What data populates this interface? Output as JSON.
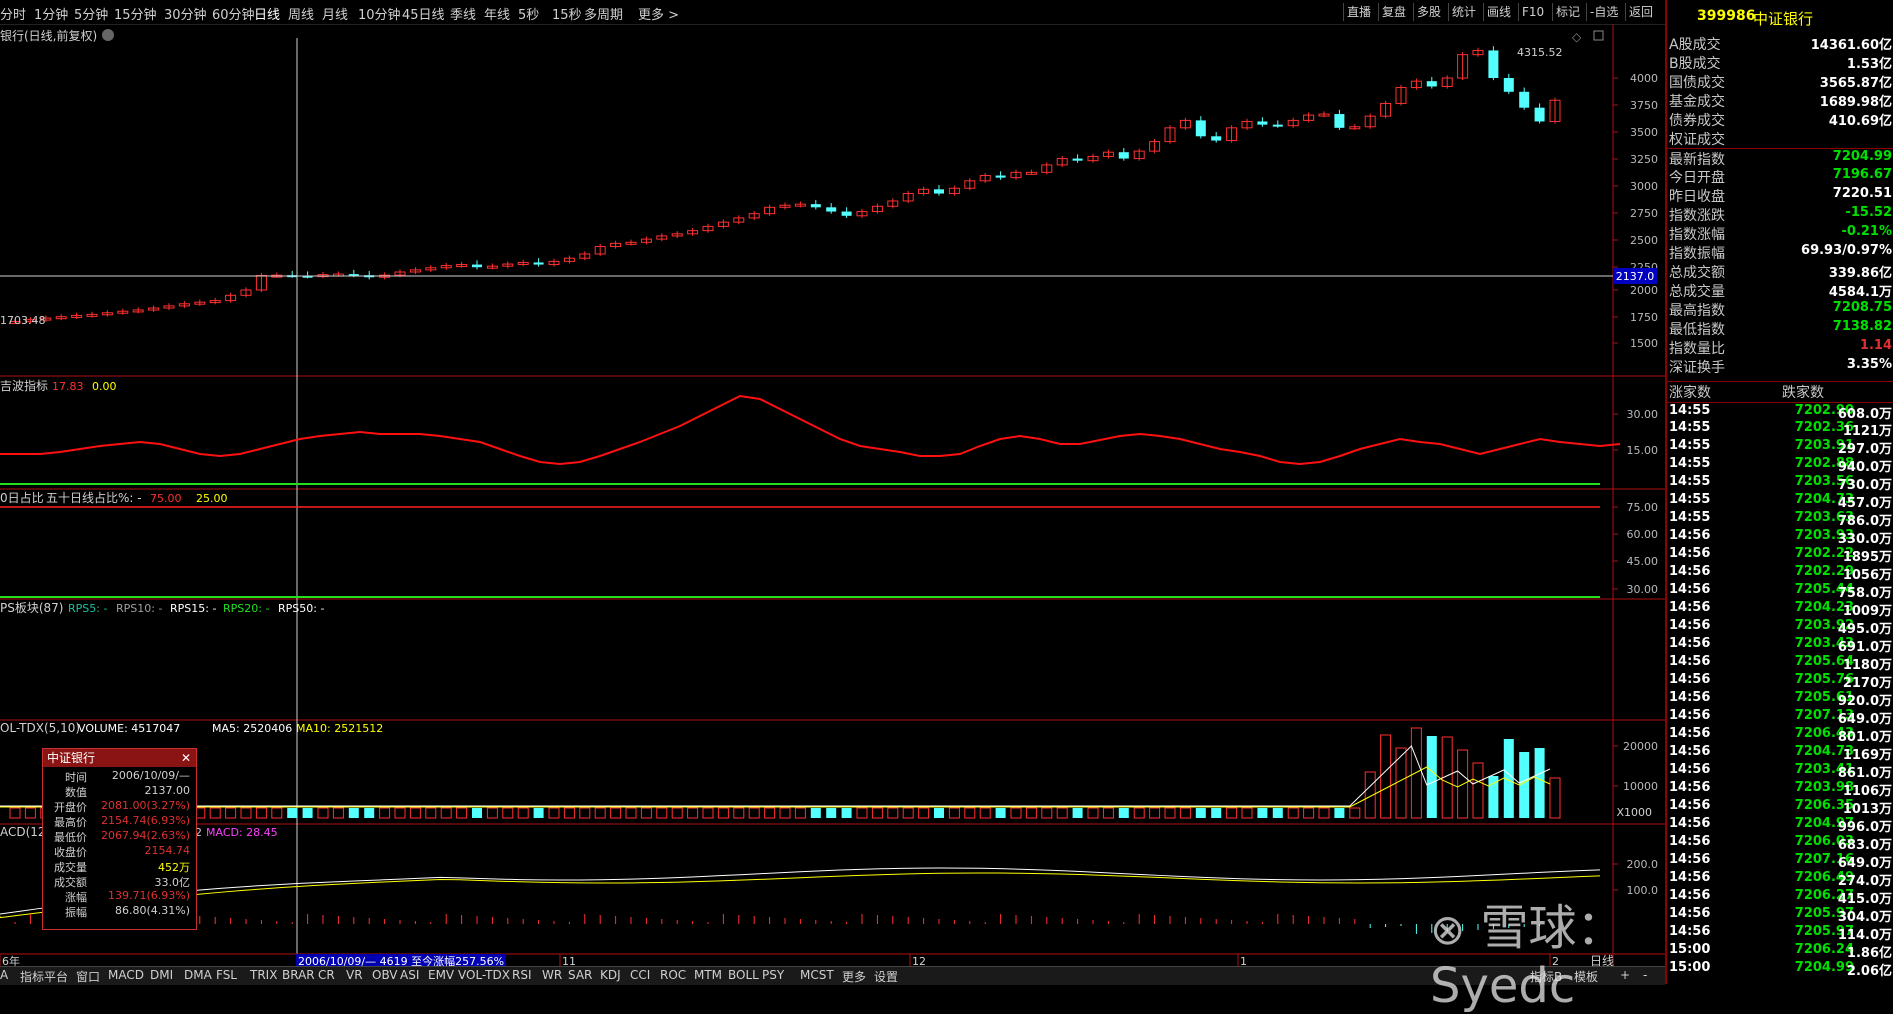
{
  "toolbar": {
    "periods": [
      "分时",
      "1分钟",
      "5分钟",
      "15分钟",
      "30分钟",
      "60分钟",
      "日线",
      "周线",
      "月线",
      "10分钟",
      "45日线",
      "季线",
      "年线",
      "5秒",
      "15秒",
      "多周期",
      "更多 >"
    ],
    "right_buttons": [
      "直播",
      "复盘",
      "多股",
      "统计",
      "画线",
      "F10",
      "标记",
      "-自选",
      "返回"
    ]
  },
  "main_chart": {
    "title": "银行(日线,前复权)",
    "high_label": "4315.52",
    "low_label": "1703.48",
    "crosshair_value": "2137.0",
    "y_ticks": [
      "4000",
      "3750",
      "3500",
      "3250",
      "3000",
      "2750",
      "2500",
      "2250",
      "2000",
      "1750",
      "1500"
    ]
  },
  "indicator_labels": {
    "wave": "吉波指标",
    "wave_val1": "17.83",
    "wave_val2": "0.00",
    "wave_ticks": [
      "30.00",
      "15.00"
    ],
    "ma50": "0日占比",
    "ma50b": "五十日线占比%: -",
    "ma50_v1": "75.00",
    "ma50_v2": "25.00",
    "ma50_ticks": [
      "75.00",
      "60.00",
      "45.00",
      "30.00"
    ],
    "rps": "PS板块(87)",
    "rps5": "RPS5: -",
    "rps10": "RPS10: -",
    "rps15": "RPS15: -",
    "rps20": "RPS20: -",
    "rps50": "RPS50: -",
    "vol": "OL-TDX(5,10)",
    "vol_v": "VOLUME: 4517047",
    "vol_ma5": "MA5: 2520406",
    "vol_ma10": "MA10: 2521512",
    "vol_ticks": [
      "20000",
      "10000"
    ],
    "vol_unit": "X1000",
    "macd": "ACD(12",
    "macd_v": "2",
    "macd_val": "MACD: 28.45",
    "macd_ticks": [
      "200.0",
      "100.0"
    ]
  },
  "xaxis": {
    "labels": [
      "6年",
      "11",
      "12",
      "1",
      "2"
    ],
    "range_text": "2006/10/09/— 4619 至今涨幅257.56%"
  },
  "bottombar": {
    "items": [
      "A",
      "指标平台",
      "窗口",
      "MACD",
      "DMI",
      "DMA",
      "FSL",
      "TRIX",
      "BRAR",
      "CR",
      "VR",
      "OBV",
      "ASI",
      "EMV",
      "VOL-TDX",
      "RSI",
      "WR",
      "SAR",
      "KDJ",
      "CCI",
      "ROC",
      "MTM",
      "BOLL",
      "PSY",
      "MCST",
      "更多",
      "设置"
    ],
    "right": [
      "指标B",
      "模板",
      "+",
      "-"
    ],
    "period": "日线"
  },
  "popup": {
    "title": "中证银行",
    "rows": [
      {
        "k": "时间",
        "v": "2006/10/09/—",
        "c": "#d0d0d0"
      },
      {
        "k": "数值",
        "v": "2137.00",
        "c": "#d0d0d0"
      },
      {
        "k": "开盘价",
        "v": "2081.00(3.27%)",
        "c": "#e03030"
      },
      {
        "k": "最高价",
        "v": "2154.74(6.93%)",
        "c": "#e03030"
      },
      {
        "k": "最低价",
        "v": "2067.94(2.63%)",
        "c": "#e03030"
      },
      {
        "k": "收盘价",
        "v": "2154.74",
        "c": "#e03030"
      },
      {
        "k": "成交量",
        "v": "452万",
        "c": "#ffff00"
      },
      {
        "k": "成交额",
        "v": "33.0亿",
        "c": "#d0d0d0"
      },
      {
        "k": "涨幅",
        "v": "139.71(6.93%)",
        "c": "#e03030"
      },
      {
        "k": "振幅",
        "v": "86.80(4.31%)",
        "c": "#d0d0d0"
      }
    ]
  },
  "rightpanel": {
    "code": "399986",
    "name": "中证银行",
    "stats": [
      {
        "label": "A股成交",
        "value": "14361.60亿",
        "color": "#ffffff"
      },
      {
        "label": "B股成交",
        "value": "1.53亿",
        "color": "#ffffff"
      },
      {
        "label": "国债成交",
        "value": "3565.87亿",
        "color": "#ffffff"
      },
      {
        "label": "基金成交",
        "value": "1689.98亿",
        "color": "#ffffff"
      },
      {
        "label": "债券成交",
        "value": "410.69亿",
        "color": "#ffffff"
      },
      {
        "label": "权证成交",
        "value": "",
        "color": "#ffffff"
      },
      {
        "label": "最新指数",
        "value": "7204.99",
        "color": "#00e000"
      },
      {
        "label": "今日开盘",
        "value": "7196.67",
        "color": "#00e000"
      },
      {
        "label": "昨日收盘",
        "value": "7220.51",
        "color": "#ffffff"
      },
      {
        "label": "指数涨跌",
        "value": "-15.52",
        "color": "#00e000"
      },
      {
        "label": "指数涨幅",
        "value": "-0.21%",
        "color": "#00e000"
      },
      {
        "label": "指数振幅",
        "value": "69.93/0.97%",
        "color": "#ffffff"
      },
      {
        "label": "总成交额",
        "value": "339.86亿",
        "color": "#ffffff"
      },
      {
        "label": "总成交量",
        "value": "4584.1万",
        "color": "#ffffff"
      },
      {
        "label": "最高指数",
        "value": "7208.75",
        "color": "#00e000"
      },
      {
        "label": "最低指数",
        "value": "7138.82",
        "color": "#00e000"
      },
      {
        "label": "指数量比",
        "value": "1.14",
        "color": "#e03030"
      },
      {
        "label": "深证换手",
        "value": "3.35%",
        "color": "#ffffff"
      }
    ],
    "up_label": "涨家数",
    "down_label": "跌家数",
    "ticks": [
      {
        "t": "14:55",
        "p": "7202.90",
        "v": "608.0万"
      },
      {
        "t": "14:55",
        "p": "7202.36",
        "v": "1121万"
      },
      {
        "t": "14:55",
        "p": "7203.91",
        "v": "297.0万"
      },
      {
        "t": "14:55",
        "p": "7202.88",
        "v": "940.0万"
      },
      {
        "t": "14:55",
        "p": "7203.56",
        "v": "730.0万"
      },
      {
        "t": "14:55",
        "p": "7204.73",
        "v": "457.0万"
      },
      {
        "t": "14:55",
        "p": "7203.63",
        "v": "786.0万"
      },
      {
        "t": "14:56",
        "p": "7203.93",
        "v": "330.0万"
      },
      {
        "t": "14:56",
        "p": "7202.22",
        "v": "1895万"
      },
      {
        "t": "14:56",
        "p": "7202.29",
        "v": "1056万"
      },
      {
        "t": "14:56",
        "p": "7205.44",
        "v": "758.0万"
      },
      {
        "t": "14:56",
        "p": "7204.23",
        "v": "1009万"
      },
      {
        "t": "14:56",
        "p": "7203.92",
        "v": "495.0万"
      },
      {
        "t": "14:56",
        "p": "7203.43",
        "v": "691.0万"
      },
      {
        "t": "14:56",
        "p": "7205.64",
        "v": "1180万"
      },
      {
        "t": "14:56",
        "p": "7205.76",
        "v": "2170万"
      },
      {
        "t": "14:56",
        "p": "7205.61",
        "v": "920.0万"
      },
      {
        "t": "14:56",
        "p": "7207.13",
        "v": "649.0万"
      },
      {
        "t": "14:56",
        "p": "7206.43",
        "v": "801.0万"
      },
      {
        "t": "14:56",
        "p": "7204.73",
        "v": "1169万"
      },
      {
        "t": "14:56",
        "p": "7203.41",
        "v": "861.0万"
      },
      {
        "t": "14:56",
        "p": "7203.98",
        "v": "1106万"
      },
      {
        "t": "14:56",
        "p": "7206.35",
        "v": "1013万"
      },
      {
        "t": "14:56",
        "p": "7204.97",
        "v": "996.0万"
      },
      {
        "t": "14:56",
        "p": "7206.03",
        "v": "683.0万"
      },
      {
        "t": "14:56",
        "p": "7207.16",
        "v": "649.0万"
      },
      {
        "t": "14:56",
        "p": "7206.49",
        "v": "274.0万"
      },
      {
        "t": "14:56",
        "p": "7206.27",
        "v": "415.0万"
      },
      {
        "t": "14:56",
        "p": "7205.97",
        "v": "304.0万"
      },
      {
        "t": "14:56",
        "p": "7205.97",
        "v": "114.0万"
      },
      {
        "t": "15:00",
        "p": "7206.24",
        "v": "1.86亿"
      },
      {
        "t": "15:00",
        "p": "7204.99",
        "v": "2.06亿"
      }
    ]
  },
  "watermark": {
    "text": "雪球：Syedc"
  }
}
